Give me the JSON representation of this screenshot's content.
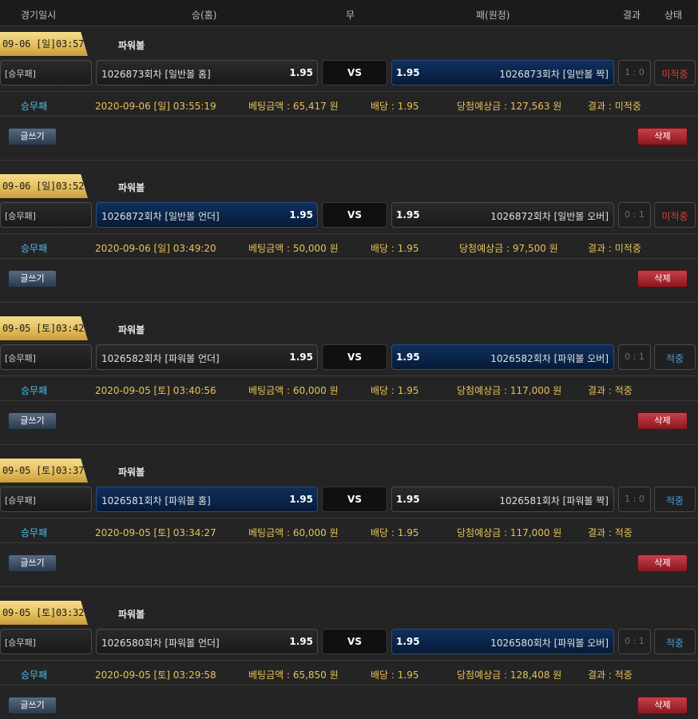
{
  "header": {
    "date": "경기일시",
    "home": "승(홈)",
    "draw": "무",
    "away": "패(원정)",
    "result": "결과",
    "status": "상태"
  },
  "vs_label": "VS",
  "write_label": "글쓰기",
  "delete_label": "삭제",
  "bets": [
    {
      "date": "09-06 [일]03:57",
      "game": "파워볼",
      "type": "[승무패]",
      "home_name": "1026873회차 [일반볼 홈]",
      "home_odd": "1.95",
      "away_odd": "1.95",
      "away_name": "1026873회차 [일반볼 짝]",
      "score": "1 : 0",
      "status": "미적중",
      "kind": "승무패",
      "time": "2020-09-06 [일] 03:55:19",
      "amount": "베팅금액 : 65,417 원",
      "odds": "배당 : 1.95",
      "expected": "당첨예상금 : 127,563 원",
      "result": "결과 : 미적중"
    },
    {
      "date": "09-06 [일]03:52",
      "game": "파워볼",
      "type": "[승무패]",
      "home_name": "1026872회차 [일반볼 언더]",
      "home_odd": "1.95",
      "away_odd": "1.95",
      "away_name": "1026872회차 [일반볼 오버]",
      "score": "0 : 1",
      "status": "미적중",
      "kind": "승무패",
      "time": "2020-09-06 [일] 03:49:20",
      "amount": "베팅금액 : 50,000 원",
      "odds": "배당 : 1.95",
      "expected": "당첨예상금 : 97,500 원",
      "result": "결과 : 미적중"
    },
    {
      "date": "09-05 [토]03:42",
      "game": "파워볼",
      "type": "[승무패]",
      "home_name": "1026582회차 [파워볼 언더]",
      "home_odd": "1.95",
      "away_odd": "1.95",
      "away_name": "1026582회차 [파워볼 오버]",
      "score": "0 : 1",
      "status": "적중",
      "kind": "승무패",
      "time": "2020-09-05 [토] 03:40:56",
      "amount": "베팅금액 : 60,000 원",
      "odds": "배당 : 1.95",
      "expected": "당첨예상금 : 117,000 원",
      "result": "결과 : 적중"
    },
    {
      "date": "09-05 [토]03:37",
      "game": "파워볼",
      "type": "[승무패]",
      "home_name": "1026581회차 [파워볼 홈]",
      "home_odd": "1.95",
      "away_odd": "1.95",
      "away_name": "1026581회차 [파워볼 짝]",
      "score": "1 : 0",
      "status": "적중",
      "kind": "승무패",
      "time": "2020-09-05 [토] 03:34:27",
      "amount": "베팅금액 : 60,000 원",
      "odds": "배당 : 1.95",
      "expected": "당첨예상금 : 117,000 원",
      "result": "결과 : 적중"
    },
    {
      "date": "09-05 [토]03:32",
      "game": "파워볼",
      "type": "[승무패]",
      "home_name": "1026580회차 [파워볼 언더]",
      "home_odd": "1.95",
      "away_odd": "1.95",
      "away_name": "1026580회차 [파워볼 오버]",
      "score": "0 : 1",
      "status": "적중",
      "kind": "승무패",
      "time": "2020-09-05 [토] 03:29:58",
      "amount": "베팅금액 : 65,850 원",
      "odds": "배당 : 1.95",
      "expected": "당첨예상금 : 128,408 원",
      "result": "결과 : 적중"
    }
  ]
}
